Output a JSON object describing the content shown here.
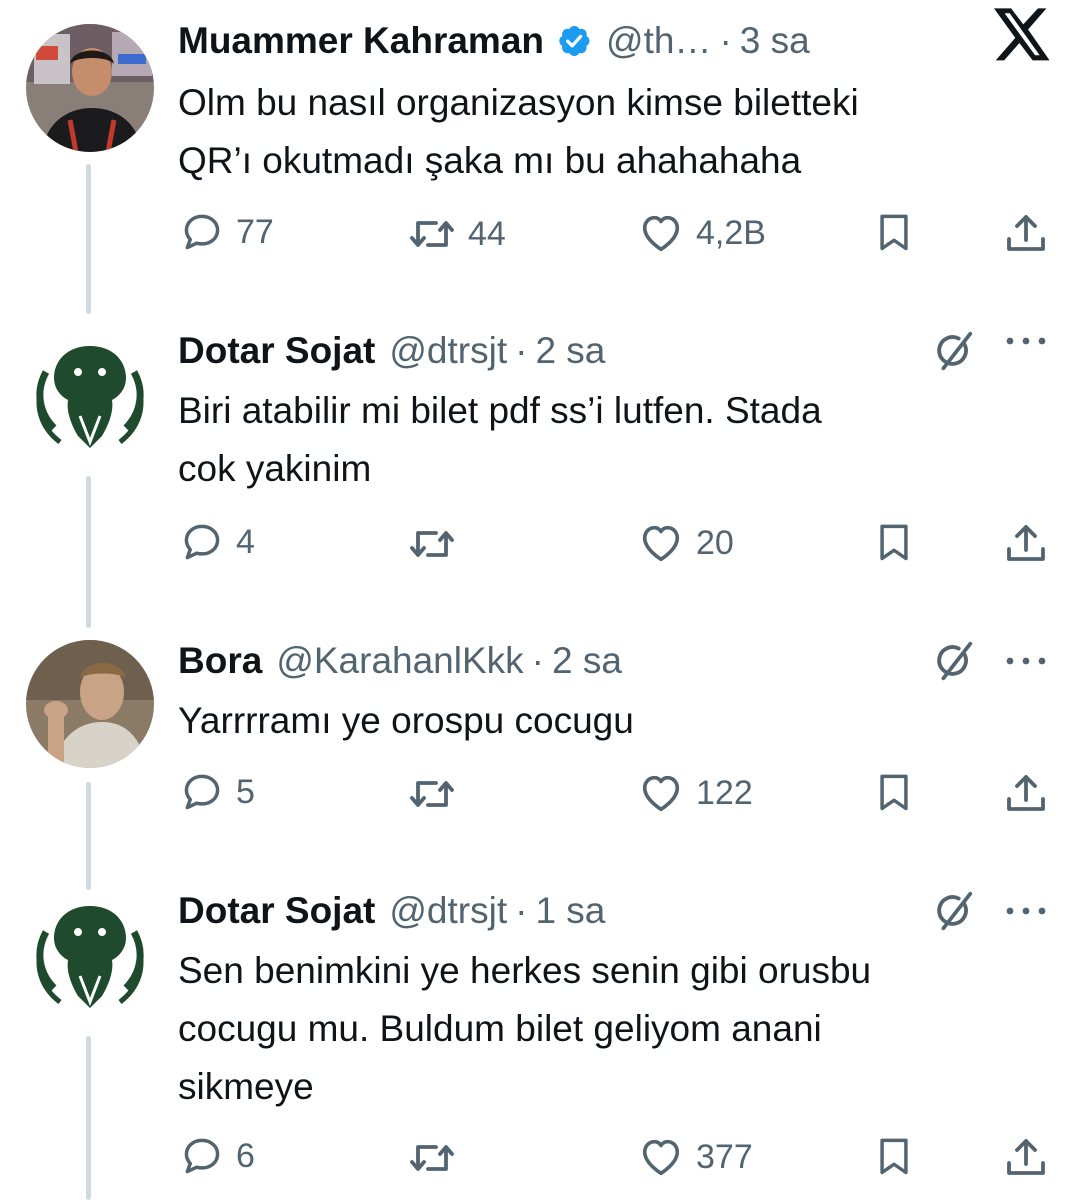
{
  "tweets": [
    {
      "name": "Muammer Kahraman",
      "handle": "@th…",
      "time": "3 sa",
      "verified": true,
      "lines": [
        "Olm bu nasıl organizasyon kimse biletteki",
        "QR’ı okutmadı şaka mı bu ahahahaha"
      ],
      "replies": "77",
      "retweets": "44",
      "likes": "4,2B"
    },
    {
      "name": "Dotar Sojat",
      "handle": "@dtrsjt",
      "time": "2 sa",
      "lines": [
        "Biri atabilir mi bilet pdf ss’i lutfen. Stada",
        "cok yakinim"
      ],
      "replies": "4",
      "retweets": "",
      "likes": "20"
    },
    {
      "name": "Bora",
      "handle": "@KarahanlKkk",
      "time": "2 sa",
      "lines": [
        "Yarrrramı ye orospu cocugu"
      ],
      "replies": "5",
      "retweets": "",
      "likes": "122"
    },
    {
      "name": "Dotar Sojat",
      "handle": "@dtrsjt",
      "time": "1 sa",
      "lines": [
        "Sen benimkini ye herkes senin gibi orusbu",
        "cocugu mu. Buldum bilet geliyom anani",
        "sikmeye"
      ],
      "replies": "6",
      "retweets": "",
      "likes": "377"
    }
  ],
  "dot": "·",
  "colors": {
    "verified": "#1d9bf0",
    "secondary": "#536471",
    "thread": "#cfd9de",
    "avatar_green": "#1f4a2e"
  },
  "icons": [
    "reply-icon",
    "retweet-icon",
    "like-icon",
    "bookmark-icon",
    "share-icon",
    "grok-icon",
    "more-icon",
    "x-logo-icon",
    "verified-badge-icon"
  ]
}
